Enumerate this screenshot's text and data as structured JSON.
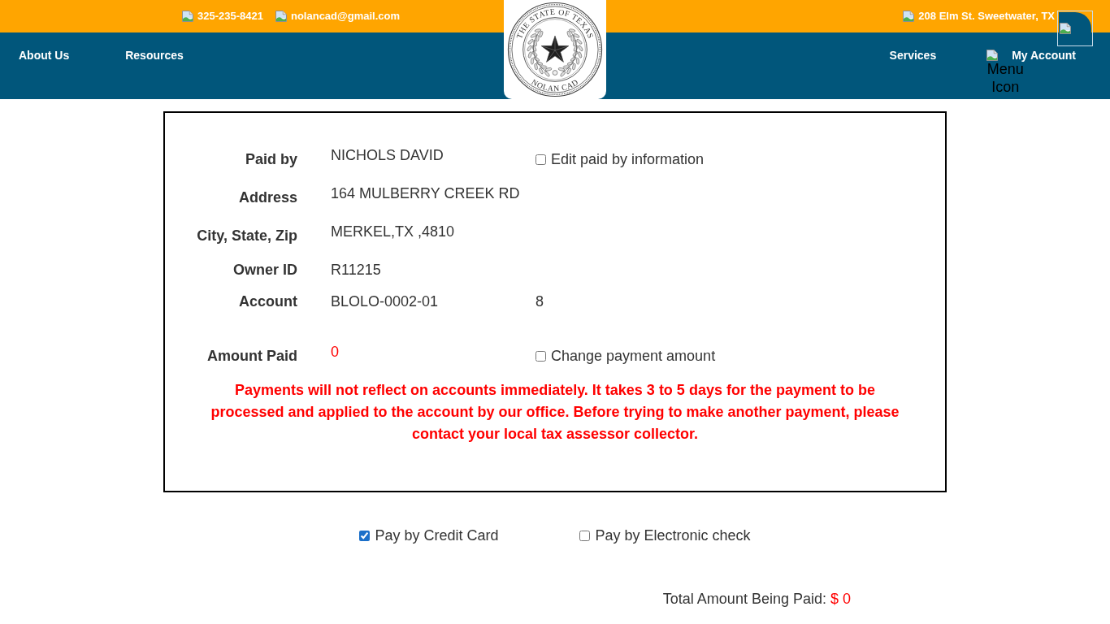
{
  "top_bar": {
    "contacts": [
      "325-235-8421",
      "nolancad@gmail.com"
    ],
    "address": "208 Elm St. Sweetwater, TX"
  },
  "logo": {
    "top_text": "THE STATE OF TEXAS",
    "bottom_text": "NOLAN CAD"
  },
  "nav": {
    "left": [
      "About Us",
      "Resources"
    ],
    "right": [
      {
        "label": "Services"
      },
      {
        "label": "My Account",
        "icon_alt": "Menu Icon"
      }
    ]
  },
  "payment_details": {
    "rows": [
      {
        "label": "Paid by",
        "value": "NICHOLS DAVID",
        "kind": "text",
        "option": {
          "label": "Edit paid by information",
          "checked": false
        }
      },
      {
        "label": "Address",
        "value": "164 MULBERRY CREEK RD",
        "kind": "text"
      },
      {
        "label": "City, State, Zip",
        "value": "MERKEL,TX ,4810",
        "kind": "text"
      },
      {
        "label": "Owner ID",
        "value": "R11215",
        "kind": "text"
      },
      {
        "label": "Account",
        "value": "BLOLO-0002-01",
        "kind": "text",
        "column_3": "8"
      },
      {
        "label": "Amount Paid",
        "value": "0",
        "kind": "amount",
        "option": {
          "label": "Change payment amount",
          "checked": false
        }
      }
    ],
    "notice": "Payments will not reflect on accounts immediately. It takes 3 to 5 days for the payment to be processed and applied to the account by our office. Before trying to make another payment, please contact your local tax assessor collector."
  },
  "payment_methods": [
    {
      "label": "Pay by Credit Card",
      "checked": true
    },
    {
      "label": "Pay by Electronic check",
      "checked": false
    }
  ],
  "total": {
    "label": "Total Amount Being Paid:",
    "amount": "$ 0"
  }
}
